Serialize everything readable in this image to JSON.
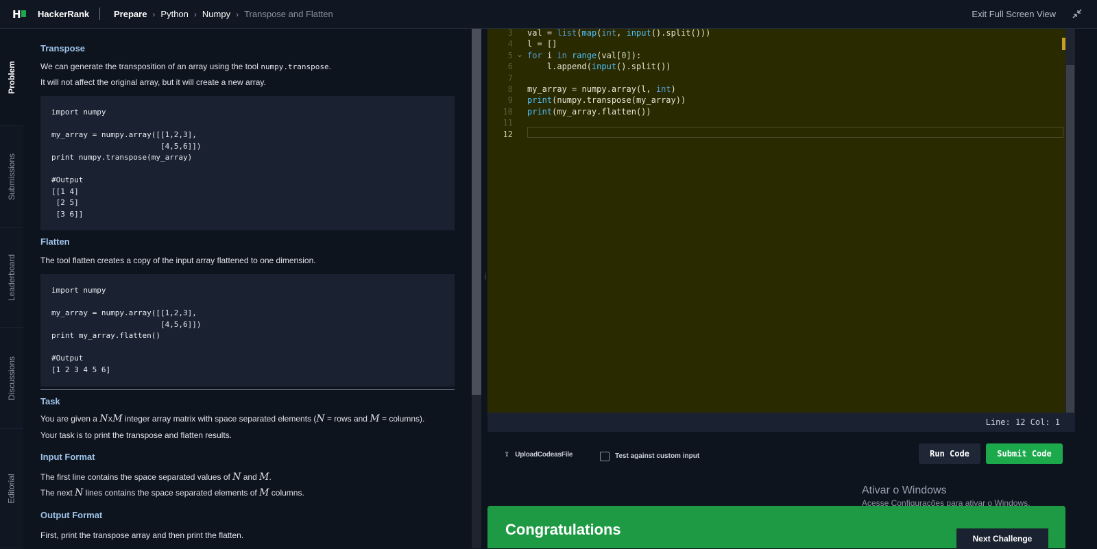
{
  "header": {
    "brand": "HackerRank",
    "breadcrumbs": [
      "Prepare",
      "Python",
      "Numpy",
      "Transpose and Flatten"
    ],
    "exit_fullscreen": "Exit Full Screen View"
  },
  "side_tabs": [
    "Problem",
    "Submissions",
    "Leaderboard",
    "Discussions",
    "Editorial"
  ],
  "problem": {
    "transpose_title": "Transpose",
    "transpose_p1_pre": "We can generate the transposition of an array using the tool ",
    "transpose_p1_code": "numpy.transpose",
    "transpose_p1_post": ".",
    "transpose_p2": "It will not affect the original array, but it will create a new array.",
    "transpose_code": "import numpy\n\nmy_array = numpy.array([[1,2,3],\n                        [4,5,6]])\nprint numpy.transpose(my_array)\n\n#Output\n[[1 4]\n [2 5]\n [3 6]]",
    "flatten_title": "Flatten",
    "flatten_p1": "The tool flatten creates a copy of the input array flattened to one dimension.",
    "flatten_code": "import numpy\n\nmy_array = numpy.array([[1,2,3],\n                        [4,5,6]])\nprint my_array.flatten()\n\n#Output\n[1 2 3 4 5 6]",
    "task_title": "Task",
    "task_p1_a": "You are given a ",
    "task_p1_math": "N",
    "task_p1_x": "X",
    "task_p1_math2": "M",
    "task_p1_b": " integer array matrix with space separated elements (",
    "task_p1_n": "N",
    "task_p1_c": " = rows and ",
    "task_p1_m": "M",
    "task_p1_d": " = columns).",
    "task_p2": "Your task is to print the transpose and flatten results.",
    "input_title": "Input Format",
    "input_p1_a": "The first line contains the space separated values of ",
    "input_p1_n": "N",
    "input_p1_b": " and ",
    "input_p1_m": "M",
    "input_p1_c": ".",
    "input_p2_a": "The next ",
    "input_p2_n": "N",
    "input_p2_b": " lines contains the space separated elements of ",
    "input_p2_m": "M",
    "input_p2_c": " columns.",
    "output_title": "Output Format",
    "output_p1": "First, print the transpose array and then print the flatten."
  },
  "editor": {
    "lines": [
      {
        "n": "3",
        "html": "val = <span class='kw'>list</span>(<span class='fn'>map</span>(<span class='kw'>int</span>, <span class='fn'>input</span>().split()))"
      },
      {
        "n": "4",
        "html": "l = []"
      },
      {
        "n": "5",
        "html": "<span class='kw'>for</span> i <span class='kw'>in</span> <span class='fn'>range</span>(val[<span class='num'>0</span>]):"
      },
      {
        "n": "6",
        "html": "    l.append(<span class='fn'>input</span>().split())"
      },
      {
        "n": "7",
        "html": ""
      },
      {
        "n": "8",
        "html": "my_array = numpy.array(l, <span class='kw'>int</span>)"
      },
      {
        "n": "9",
        "html": "<span class='fn'>print</span>(numpy.transpose(my_array))"
      },
      {
        "n": "10",
        "html": "<span class='fn'>print</span>(my_array.flatten())"
      },
      {
        "n": "11",
        "html": ""
      },
      {
        "n": "12",
        "html": ""
      }
    ],
    "status": "Line: 12 Col: 1"
  },
  "actions": {
    "upload": "UploadCodeasFile",
    "test_custom": "Test against custom input",
    "run": "Run Code",
    "submit": "Submit Code"
  },
  "windows_watermark": {
    "title": "Ativar o Windows",
    "subtitle": "Acesse Configurações para ativar o Windows."
  },
  "result": {
    "title": "Congratulations",
    "next_button": "Next Challenge"
  }
}
